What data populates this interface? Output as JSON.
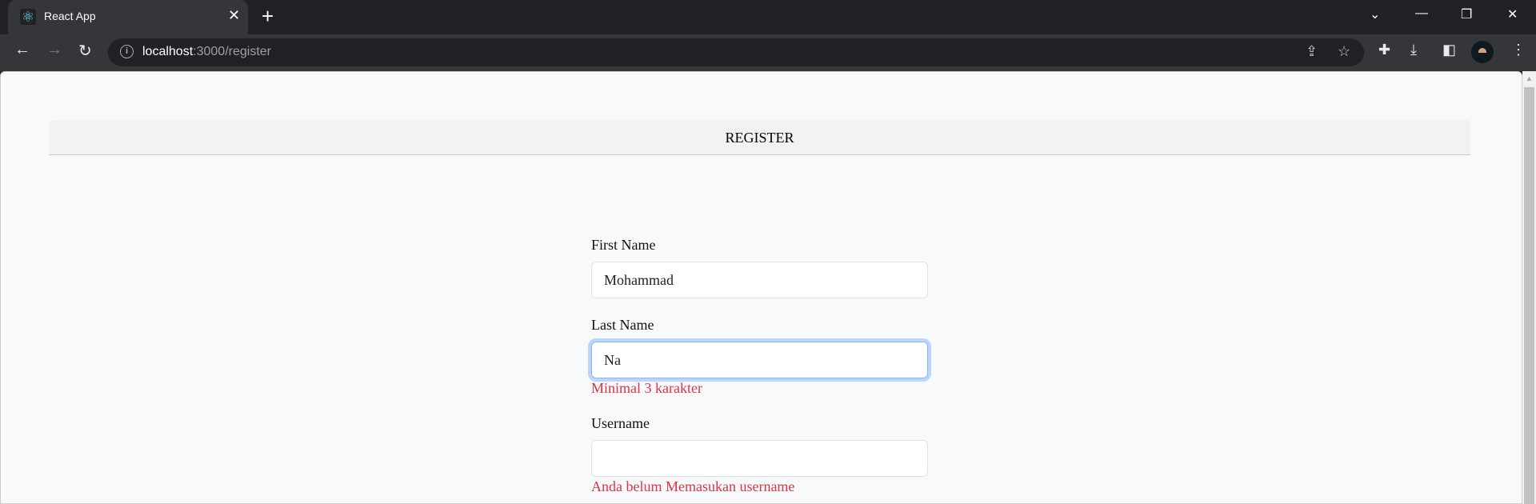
{
  "browser": {
    "tab_title": "React App",
    "url_host": "localhost",
    "url_rest": ":3000/register"
  },
  "page": {
    "header": "REGISTER",
    "fields": [
      {
        "label": "First Name",
        "value": "Mohammad",
        "error": ""
      },
      {
        "label": "Last Name",
        "value": "Na",
        "error": "Minimal 3 karakter"
      },
      {
        "label": "Username",
        "value": "",
        "error": "Anda belum Memasukan username"
      }
    ]
  },
  "colors": {
    "error": "#dc3545",
    "focus": "#86b7fe"
  }
}
